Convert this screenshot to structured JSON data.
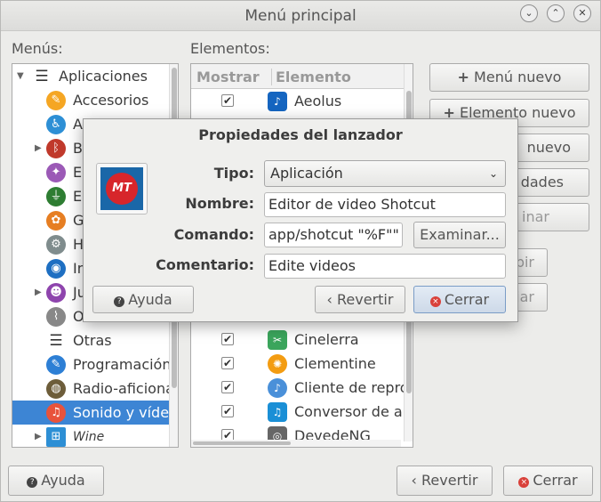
{
  "window": {
    "title": "Menú principal",
    "menus_label": "Menús:",
    "elements_label": "Elementos:",
    "controls": {
      "minimize": "⌄",
      "maximize": "⌃",
      "close": "✕"
    }
  },
  "menus": [
    {
      "label": "Aplicaciones",
      "icon": "list-icon",
      "color": "#333333",
      "expanded": true
    },
    {
      "label": "Accesorios",
      "icon": "wrench-icon",
      "color": "#f5a623"
    },
    {
      "label": "Accesibilidad",
      "icon": "accessibility-icon",
      "color": "#2d8fd5"
    },
    {
      "label": "Bluetooth",
      "icon": "bluetooth-icon",
      "color": "#c0392b"
    },
    {
      "label": "Educación",
      "icon": "education-icon",
      "color": "#9b59b6"
    },
    {
      "label": "Electrónica",
      "icon": "electronics-icon",
      "color": "#2e7d32"
    },
    {
      "label": "Gráficos",
      "icon": "graphics-icon",
      "color": "#e67e22"
    },
    {
      "label": "Herramientas",
      "icon": "gear-icon",
      "color": "#7f8c8d"
    },
    {
      "label": "Internet",
      "icon": "globe-icon",
      "color": "#1e6fc2"
    },
    {
      "label": "Juegos",
      "icon": "game-icon",
      "color": "#8e44ad"
    },
    {
      "label": "Oficina",
      "icon": "paperclip-icon",
      "color": "#888888"
    },
    {
      "label": "Otras",
      "icon": "list-icon",
      "color": "#333333"
    },
    {
      "label": "Programación",
      "icon": "programming-icon",
      "color": "#2d7fd5"
    },
    {
      "label": "Radio-aficionado",
      "icon": "radio-icon",
      "color": "#6d5d3a"
    },
    {
      "label": "Sonido y vídeo",
      "icon": "music-icon",
      "color": "#e8533b",
      "selected": true
    },
    {
      "label": "Wine",
      "icon": "windows-icon",
      "color": "#2d8fd5",
      "italic": true
    }
  ],
  "elements": {
    "headers": {
      "show": "Mostrar",
      "element": "Elemento"
    },
    "rows": [
      {
        "label": "Aeolus",
        "icon": "music-note-icon",
        "color": "#1565c0",
        "checked": true
      },
      {
        "label": "Cinelerra",
        "icon": "film-icon",
        "color": "#3ba55c",
        "checked": true
      },
      {
        "label": "Clementine",
        "icon": "orange-icon",
        "color": "#f39c12",
        "checked": true
      },
      {
        "label": "Cliente de reproducción",
        "icon": "music-note-icon",
        "color": "#4a90d9",
        "checked": true
      },
      {
        "label": "Conversor de audio",
        "icon": "music-convert-icon",
        "color": "#1a8fd6",
        "checked": true
      },
      {
        "label": "DevedeNG",
        "icon": "disc-icon",
        "color": "#666666",
        "checked": true
      }
    ]
  },
  "side_buttons": {
    "new_menu": "Menú nuevo",
    "new_element": "Elemento nuevo",
    "new_separator": "nuevo",
    "properties": "dades",
    "delete": "inar",
    "move_up": "bir",
    "move_down": "jar"
  },
  "bottom": {
    "help": "Ayuda",
    "revert": "Revertir",
    "close": "Cerrar"
  },
  "dialog": {
    "title": "Propiedades del lanzador",
    "type_label": "Tipo:",
    "type_value": "Aplicación",
    "name_label": "Nombre:",
    "name_value": "Editor de video Shotcut",
    "command_label": "Comando:",
    "command_value": "app/shotcut \"%F\"\"",
    "browse": "Examinar...",
    "comment_label": "Comentario:",
    "comment_value": "Edite videos",
    "help": "Ayuda",
    "revert": "Revertir",
    "close": "Cerrar"
  }
}
